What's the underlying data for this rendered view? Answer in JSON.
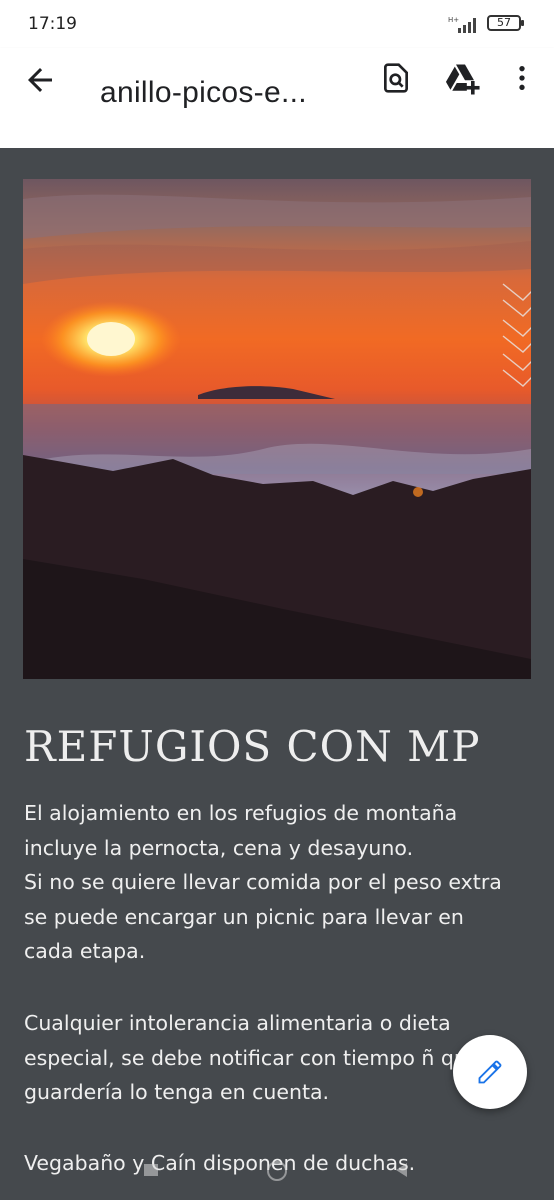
{
  "status": {
    "time": "17:19",
    "network": "H+",
    "battery": "57"
  },
  "toolbar": {
    "back_label": "Back",
    "title": "anillo-picos-e...",
    "icons": [
      "back-arrow-icon",
      "find-in-document-icon",
      "add-to-drive-icon",
      "more-vert-icon"
    ]
  },
  "document": {
    "heading": "REFUGIOS CON MP",
    "paragraph1": "El alojamiento en los refugios de montaña incluye la pernocta, cena y desayuno.\nSi no se quiere llevar comida por el peso extra se puede encargar un picnic para llevar en cada etapa.",
    "paragraph2": "Cualquier intolerancia alimentaria o dieta especial, se debe notificar con tiempo ñ que la guardería lo tenga en cuenta.",
    "paragraph3": "Vegabaño y Caín disponen de duchas."
  },
  "fab": {
    "icon": "edit-pencil-icon"
  },
  "colors": {
    "page_bg": "#45494d",
    "toolbar_bg": "#ffffff",
    "text_light": "#efefef",
    "fab_icon": "#1a73e8"
  }
}
